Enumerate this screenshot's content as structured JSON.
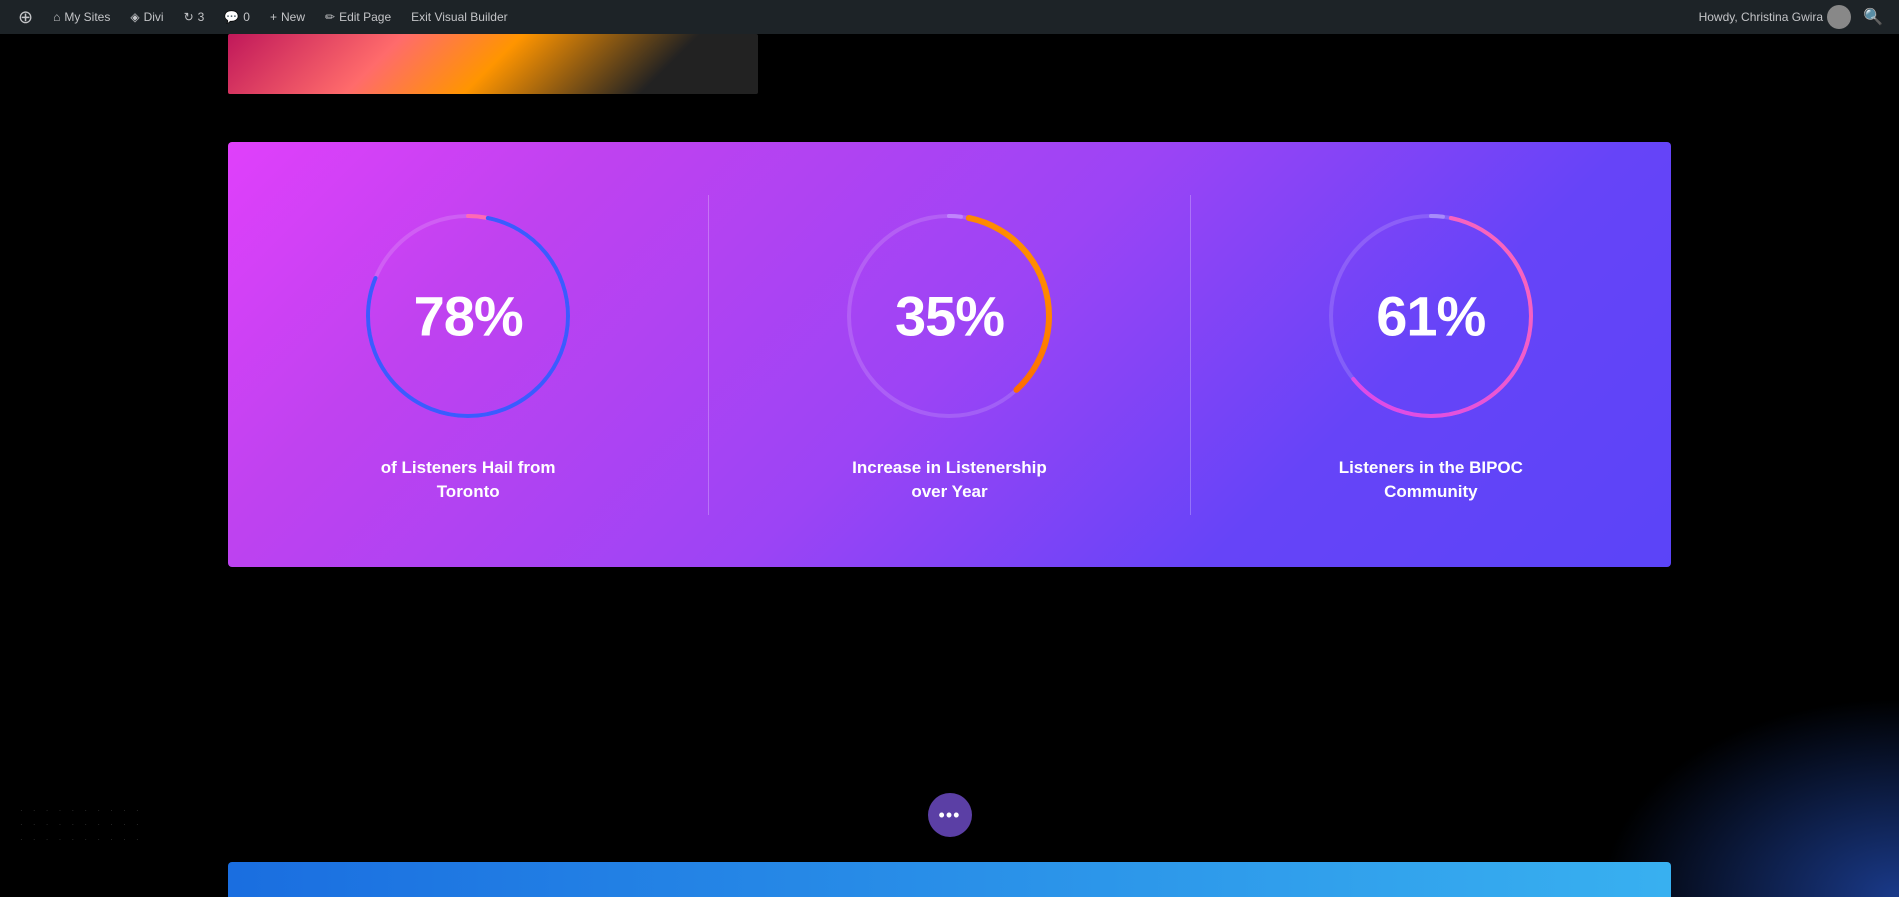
{
  "adminBar": {
    "wpIcon": "⊕",
    "mySites": "My Sites",
    "divi": "Divi",
    "updates": "3",
    "comments": "0",
    "new": "New",
    "editPage": "Edit Page",
    "exitBuilder": "Exit Visual Builder",
    "userGreeting": "Howdy, Christina Gwira"
  },
  "stats": [
    {
      "id": "stat-1",
      "percent": "78%",
      "value": 78,
      "label": "of Listeners Hail from Toronto",
      "circleColor": "#3b5bff",
      "accentColor": "#ff69b4"
    },
    {
      "id": "stat-2",
      "percent": "35%",
      "value": 35,
      "label": "Increase in Listenership over Year",
      "circleColor": "#ff6600",
      "accentColor": "#c084fc"
    },
    {
      "id": "stat-3",
      "percent": "61%",
      "value": 61,
      "label": "Listeners in the BIPOC Community",
      "circleColor": "#ff69b4",
      "accentColor": "#c084fc"
    }
  ],
  "dotsButton": {
    "label": "•••"
  }
}
